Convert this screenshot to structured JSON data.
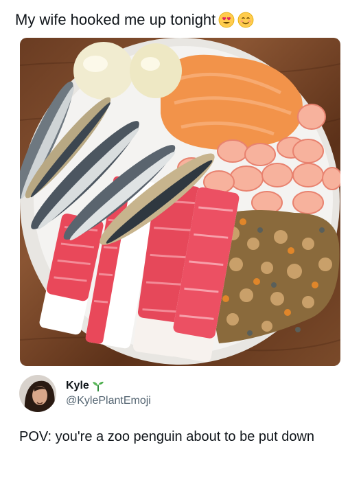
{
  "post": {
    "caption": "My wife hooked me up tonight",
    "emojis": [
      "heart-eyes-emoji",
      "smiling-emoji"
    ]
  },
  "photo": {
    "icon": "food-bowl-photo",
    "colors": {
      "table": "#7a4a2a",
      "bowl": "#f4f3f1",
      "sauce": "#f2934a",
      "shrimp": "#f7b29d",
      "crab_red": "#e9485a",
      "fish": "#6e7880"
    }
  },
  "reply": {
    "author_name": "Kyle",
    "author_badge": "seedling-icon",
    "author_handle": "@KylePlantEmoji",
    "text": "POV: you're a zoo penguin about to be put down"
  }
}
